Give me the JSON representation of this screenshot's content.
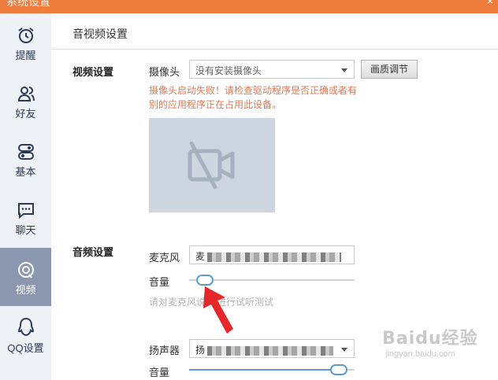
{
  "window": {
    "title": "系统设置",
    "close_glyph": "×"
  },
  "sidebar": {
    "items": [
      {
        "label": "提醒",
        "icon": "alarm-clock-icon",
        "active": false
      },
      {
        "label": "好友",
        "icon": "friends-icon",
        "active": false
      },
      {
        "label": "基本",
        "icon": "toggle-icon",
        "active": false
      },
      {
        "label": "聊天",
        "icon": "chat-bubble-icon",
        "active": false
      },
      {
        "label": "视频",
        "icon": "video-camera-icon",
        "active": true
      },
      {
        "label": "QQ设置",
        "icon": "penguin-icon",
        "active": false
      }
    ]
  },
  "main": {
    "title": "音视频设置",
    "video": {
      "section_label": "视频设置",
      "camera_label": "摄像头",
      "camera_value": "没有安装摄像头",
      "quality_button": "画质调节",
      "error": "摄像头启动失败！请检查驱动程序是否正确或者有别的应用程序正在占用此设备。",
      "preview_icon": "camera-off-icon"
    },
    "audio": {
      "section_label": "音频设置",
      "mic_label": "麦克风",
      "mic_value_visible": "麦",
      "volume_label": "音量",
      "mic_volume": 0.05,
      "hint_left": "请对麦克风说",
      "hint_right": "进行试听测试",
      "speaker_label": "扬声器",
      "speaker_value_visible": "扬",
      "speaker_volume_label": "音量",
      "speaker_volume": 0.95
    }
  },
  "watermark": {
    "brand": "Baidu经验",
    "url": "jingyan.baidu.com"
  },
  "colors": {
    "titlebar": "#ee7c3c",
    "active_nav": "#8b97ae",
    "error": "#e07a56",
    "slider": "#5b9bd5",
    "arrow": "#e5262b"
  }
}
